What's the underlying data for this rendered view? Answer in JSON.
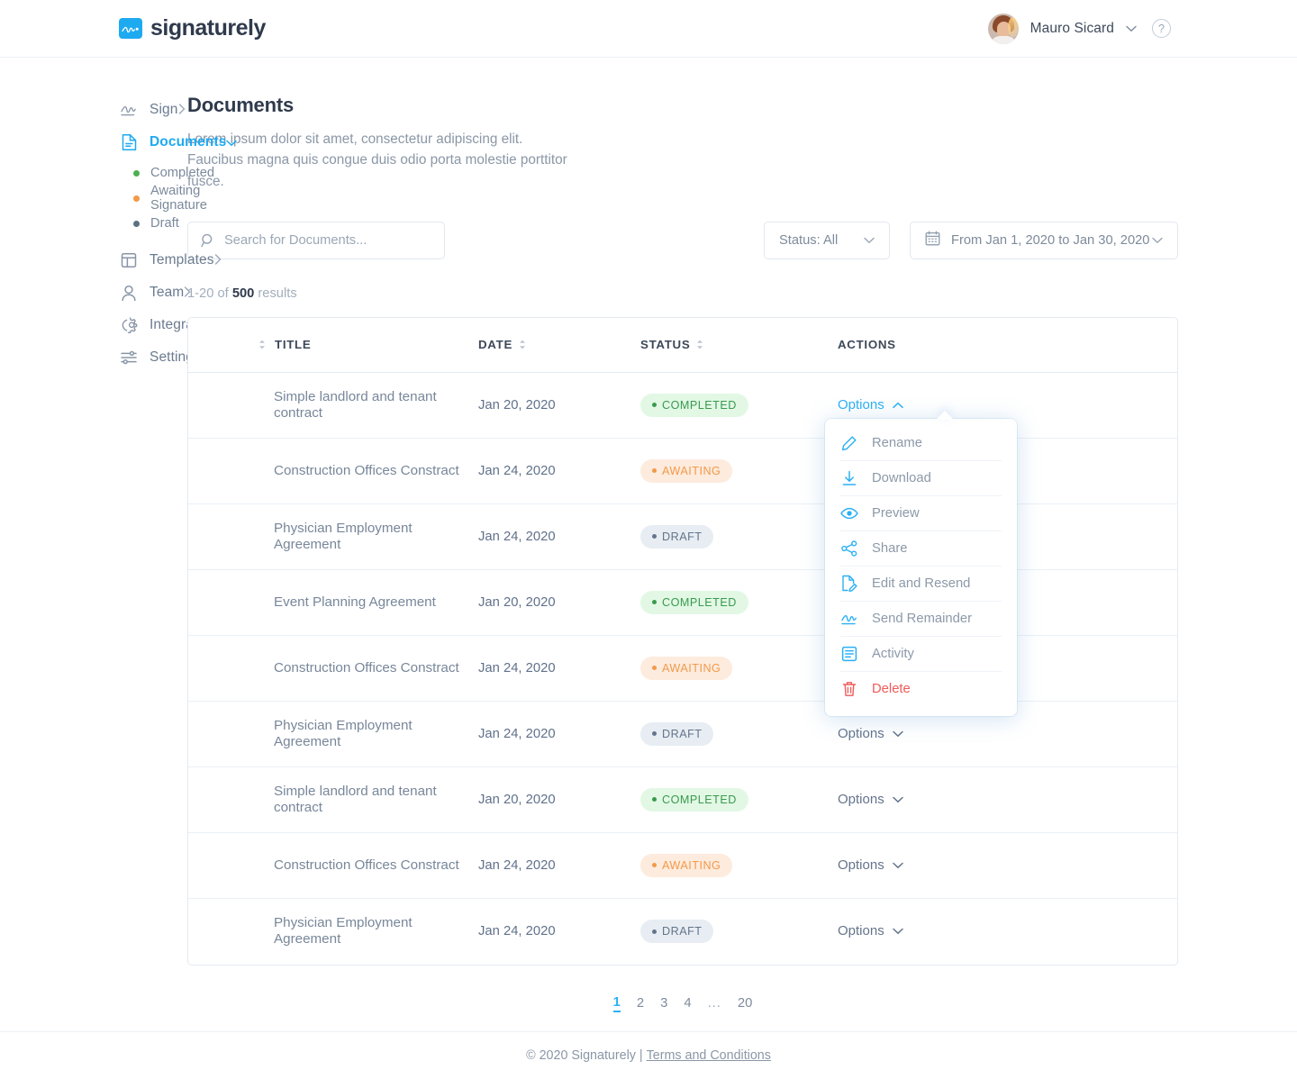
{
  "brand": {
    "name": "signaturely",
    "mark_icon": "signature-mark-icon"
  },
  "header": {
    "user_name": "Mauro Sicard",
    "user_chevron_icon": "chevron-down-icon",
    "help_label": "?",
    "avatar_alt": "Mauro Sicard avatar"
  },
  "sidebar": {
    "items": [
      {
        "label": "Sign",
        "icon": "signature-icon",
        "arrow": "chevron-right-icon",
        "active": false
      },
      {
        "label": "Documents",
        "icon": "document-icon",
        "arrow": "chevron-down-icon",
        "active": true
      },
      {
        "label": "Templates",
        "icon": "templates-icon",
        "arrow": "chevron-right-icon",
        "active": false
      },
      {
        "label": "Team",
        "icon": "person-icon",
        "arrow": "chevron-right-icon",
        "active": false
      },
      {
        "label": "Integrations",
        "icon": "gear-icon",
        "arrow": "chevron-right-icon",
        "active": false
      },
      {
        "label": "Settings",
        "icon": "sliders-icon",
        "arrow": "chevron-right-icon",
        "active": false
      }
    ],
    "sub_items": [
      {
        "label": "Completed",
        "color": "#4caf50"
      },
      {
        "label": "Awaiting Signature",
        "color": "#f2994a"
      },
      {
        "label": "Draft",
        "color": "#5b7083"
      }
    ]
  },
  "main": {
    "title": "Documents",
    "description": "Lorem ipsum dolor sit amet, consectetur adipiscing elit. Faucibus magna quis congue duis odio porta molestie porttitor fusce.",
    "results_prefix": "1-20 of ",
    "results_count": "500",
    "results_suffix": " results"
  },
  "search": {
    "placeholder": "Search for Documents...",
    "value": "",
    "icon": "search-icon"
  },
  "status_filter": {
    "label": "Status: All",
    "chevron_icon": "chevron-down-icon"
  },
  "date_filter": {
    "label": "From Jan 1, 2020 to Jan  30, 2020",
    "icon": "calendar-icon",
    "chevron_icon": "chevron-down-icon"
  },
  "table": {
    "columns": [
      {
        "label": "TITLE",
        "sortable": true,
        "sort_side": "left"
      },
      {
        "label": "DATE",
        "sortable": true,
        "sort_side": "right"
      },
      {
        "label": "STATUS",
        "sortable": true,
        "sort_side": "right"
      },
      {
        "label": "ACTIONS",
        "sortable": false,
        "sort_side": "none"
      }
    ],
    "actions_label": "Options",
    "rows": [
      {
        "title": "Simple landlord and tenant contract",
        "date": "Jan 20, 2020",
        "status": "COMPLETED",
        "status_type": "completed",
        "menu_open": true
      },
      {
        "title": "Construction Offices Constract",
        "date": "Jan 24, 2020",
        "status": "AWAITING",
        "status_type": "awaiting",
        "menu_open": false
      },
      {
        "title": "Physician Employment Agreement",
        "date": "Jan 24, 2020",
        "status": "DRAFT",
        "status_type": "draft",
        "menu_open": false
      },
      {
        "title": "Event Planning Agreement",
        "date": "Jan 20, 2020",
        "status": "COMPLETED",
        "status_type": "completed",
        "menu_open": false
      },
      {
        "title": "Construction Offices Constract",
        "date": "Jan 24, 2020",
        "status": "AWAITING",
        "status_type": "awaiting",
        "menu_open": false
      },
      {
        "title": "Physician Employment Agreement",
        "date": "Jan 24, 2020",
        "status": "DRAFT",
        "status_type": "draft",
        "menu_open": false
      },
      {
        "title": "Simple landlord and tenant contract",
        "date": "Jan 20, 2020",
        "status": "COMPLETED",
        "status_type": "completed",
        "menu_open": false
      },
      {
        "title": "Construction Offices Constract",
        "date": "Jan 24, 2020",
        "status": "AWAITING",
        "status_type": "awaiting",
        "menu_open": false
      },
      {
        "title": "Physician Employment Agreement",
        "date": "Jan 24, 2020",
        "status": "DRAFT",
        "status_type": "draft",
        "menu_open": false
      }
    ]
  },
  "options_menu": {
    "items": [
      {
        "label": "Rename",
        "icon": "pencil-icon",
        "danger": false
      },
      {
        "label": "Download",
        "icon": "download-icon",
        "danger": false
      },
      {
        "label": "Preview",
        "icon": "eye-icon",
        "danger": false
      },
      {
        "label": "Share",
        "icon": "share-icon",
        "danger": false
      },
      {
        "label": "Edit and Resend",
        "icon": "document-edit-icon",
        "danger": false
      },
      {
        "label": "Send Remainder",
        "icon": "signature-icon",
        "danger": false
      },
      {
        "label": "Activity",
        "icon": "activity-list-icon",
        "danger": false
      },
      {
        "label": "Delete",
        "icon": "trash-icon",
        "danger": true
      }
    ]
  },
  "pagination": {
    "pages": [
      "1",
      "2",
      "3",
      "4",
      "...",
      "20"
    ],
    "current": "1"
  },
  "footer": {
    "copyright": "© 2020 Signaturely",
    "separator": "|",
    "link": "Terms and Conditions"
  },
  "colors": {
    "accent": "#1eaaf1",
    "completed_bg": "#e2f8e5",
    "completed_fg": "#3a9a4e",
    "awaiting_bg": "#fdebdd",
    "awaiting_fg": "#f2994a",
    "draft_bg": "#e7edf3",
    "draft_fg": "#64748b",
    "danger": "#f05a5a",
    "text_dark": "#2f3a4c",
    "text_muted": "#8b97a7"
  }
}
